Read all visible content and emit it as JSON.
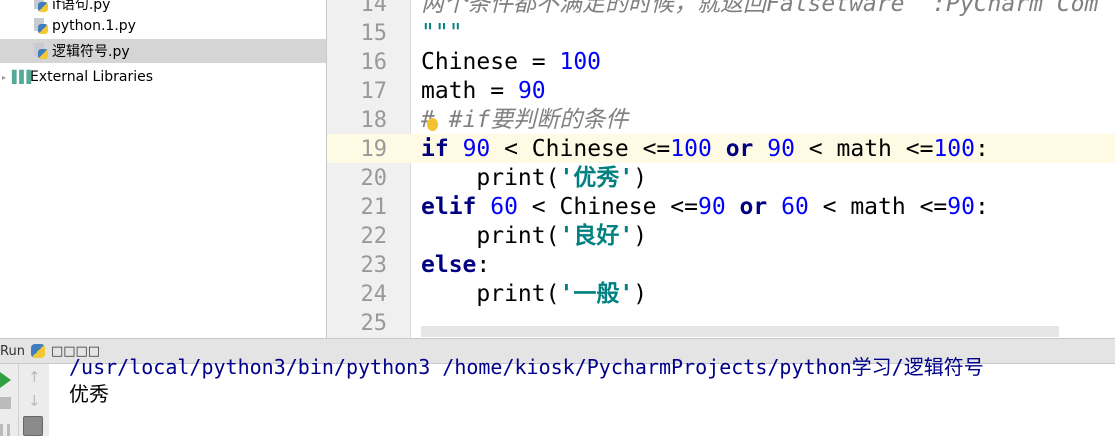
{
  "project_tree": {
    "files": [
      "if语句.py",
      "python.1.py",
      "逻辑符号.py"
    ],
    "selected": "逻辑符号.py",
    "external": "External Libraries"
  },
  "editor": {
    "line_numbers": [
      "14",
      "15",
      "16",
      "17",
      "18",
      "19",
      "20",
      "21",
      "22",
      "23",
      "24",
      "25"
    ],
    "line14": "两个条件都不满足的时候，就返回Falsetware  :PyCharm Com",
    "line15": "\"\"\"",
    "l16": {
      "a": "Chinese = ",
      "b": "100"
    },
    "l17": {
      "a": "math = ",
      "b": "90"
    },
    "l18": "# #if要判断的条件",
    "l19": {
      "kw": "if",
      "n1": "90",
      "t1": " < Chinese <=",
      "n2": "100",
      "or": "or",
      "n3": "90",
      "t2": " < math <=",
      "n4": "100",
      "end": ":"
    },
    "l20": {
      "f": "    print(",
      "s": "'优秀'",
      "e": ")"
    },
    "l21": {
      "kw": "elif",
      "n1": "60",
      "t1": " < Chinese <=",
      "n2": "90",
      "or": "or",
      "n3": "60",
      "t2": " < math <=",
      "n4": "90",
      "end": ":"
    },
    "l22": {
      "f": "    print(",
      "s": "'良好'",
      "e": ")"
    },
    "l23": {
      "kw": "else",
      "end": ":"
    },
    "l24": {
      "f": "    print(",
      "s": "'一般'",
      "e": ")"
    }
  },
  "run": {
    "label": "Run",
    "config": "□□□□",
    "command": "/usr/local/python3/bin/python3 /home/kiosk/PycharmProjects/python学习/逻辑符号",
    "output": "优秀"
  }
}
